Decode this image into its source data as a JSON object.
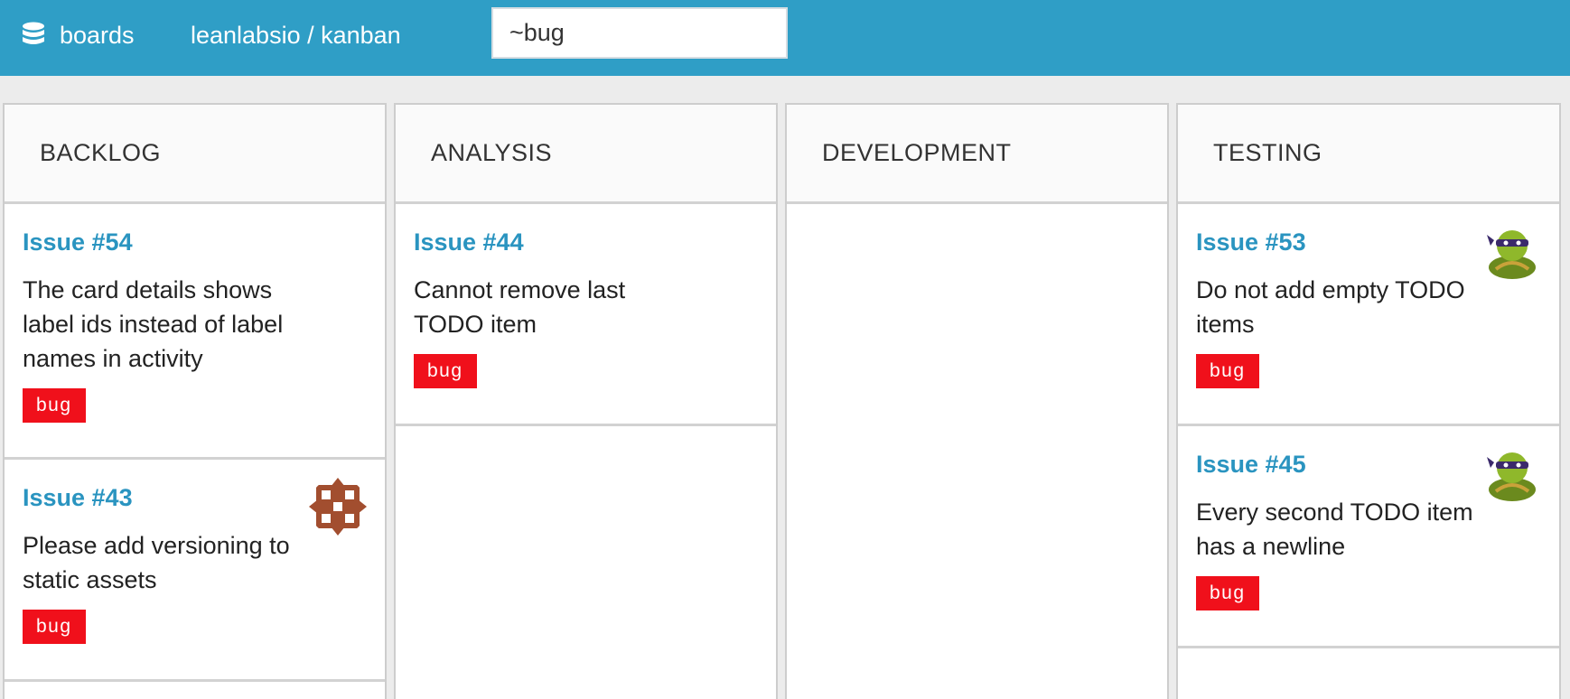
{
  "topbar": {
    "brand_icon": "database-icon",
    "brand_label": "boards",
    "project_path": "leanlabsio / kanban",
    "search_value": "~bug"
  },
  "colors": {
    "topbar": "#2f9ec6",
    "issue_link": "#2a94c0",
    "bug_label": "#f0101b"
  },
  "columns": [
    {
      "title": "BACKLOG",
      "cards": [
        {
          "title": "Issue #54",
          "text": "The card details shows label ids instead of label names in activity",
          "label": "bug",
          "avatar": null
        },
        {
          "title": "Issue #43",
          "text": "Please add versioning to static assets",
          "label": "bug",
          "avatar": "pattern-avatar-icon"
        }
      ]
    },
    {
      "title": "ANALYSIS",
      "cards": [
        {
          "title": "Issue #44",
          "text": "Cannot remove last TODO item",
          "label": "bug",
          "avatar": null
        }
      ]
    },
    {
      "title": "DEVELOPMENT",
      "cards": []
    },
    {
      "title": "TESTING",
      "cards": [
        {
          "title": "Issue #53",
          "text": "Do not add empty TODO items",
          "label": "bug",
          "avatar": "turtle-avatar-icon"
        },
        {
          "title": "Issue #45",
          "text": "Every second TODO item has a newline",
          "label": "bug",
          "avatar": "turtle-avatar-icon"
        }
      ]
    }
  ]
}
